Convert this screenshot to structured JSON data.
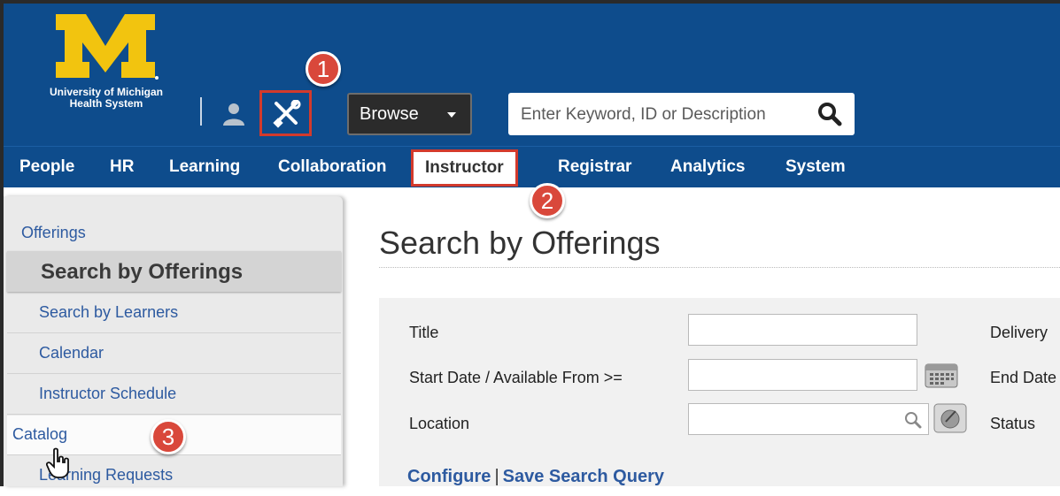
{
  "header": {
    "logo_lines": [
      "University of Michigan",
      "Health System"
    ],
    "browse_label": "Browse",
    "search_placeholder": "Enter Keyword, ID or Description",
    "colors": {
      "header_bg": "#0e4c8c",
      "logo_gold": "#f2c40f",
      "highlight": "#d33a2c"
    }
  },
  "callouts": [
    "1",
    "2",
    "3"
  ],
  "nav": {
    "items": [
      "People",
      "HR",
      "Learning",
      "Collaboration",
      "Instructor",
      "Registrar",
      "Analytics",
      "System"
    ],
    "active": "Instructor"
  },
  "sidebar": {
    "section_link": "Offerings",
    "current": "Search by Offerings",
    "items": [
      "Search by Learners",
      "Calendar",
      "Instructor Schedule",
      "Catalog",
      "Learning Requests"
    ]
  },
  "main": {
    "title": "Search by Offerings",
    "fields": {
      "title_label": "Title",
      "start_date_label": "Start Date / Available From >=",
      "location_label": "Location",
      "delivery_label": "Delivery",
      "end_date_label": "End Date",
      "status_label": "Status"
    },
    "links": {
      "configure": "Configure",
      "save_query": "Save Search Query"
    }
  }
}
